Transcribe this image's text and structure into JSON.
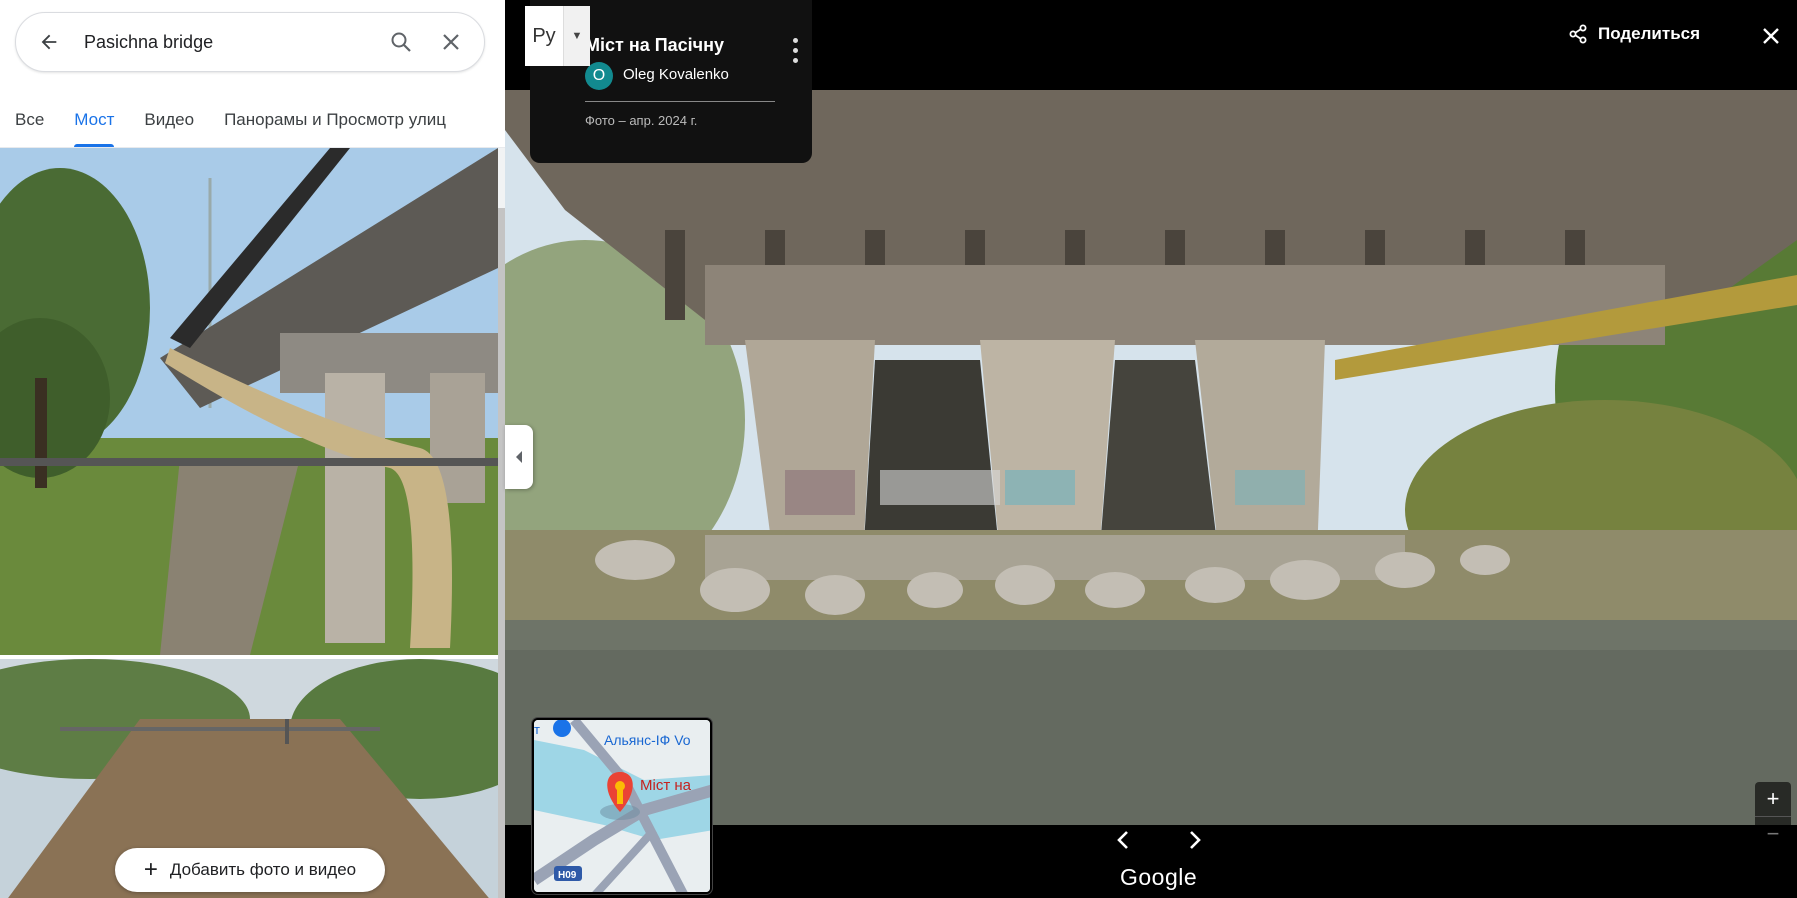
{
  "search": {
    "query": "Pasichna bridge",
    "back_icon": "arrow-back-icon",
    "search_icon": "search-icon",
    "clear_icon": "close-icon"
  },
  "tabs": [
    {
      "label": "Все",
      "active": false
    },
    {
      "label": "Мост",
      "active": true
    },
    {
      "label": "Видео",
      "active": false
    },
    {
      "label": "Панорамы и Просмотр улиц",
      "active": false
    }
  ],
  "add_photo": {
    "label": "Добавить фото и видео"
  },
  "viewer": {
    "language_code": "Ру",
    "title": "Міст на Пасічну",
    "author_initial": "O",
    "author_name": "Oleg Kovalenko",
    "date": "Фото – апр. 2024 г.",
    "share_label": "Поделиться",
    "brand": "Google"
  },
  "minimap": {
    "label_top": "Альянс-ІФ Vo",
    "label_place": "Міст на",
    "label_prefix": "т",
    "road_badge": "H09"
  },
  "colors": {
    "accent": "#1a73e8",
    "avatar": "#128a8f",
    "pin": "#ea4335"
  }
}
